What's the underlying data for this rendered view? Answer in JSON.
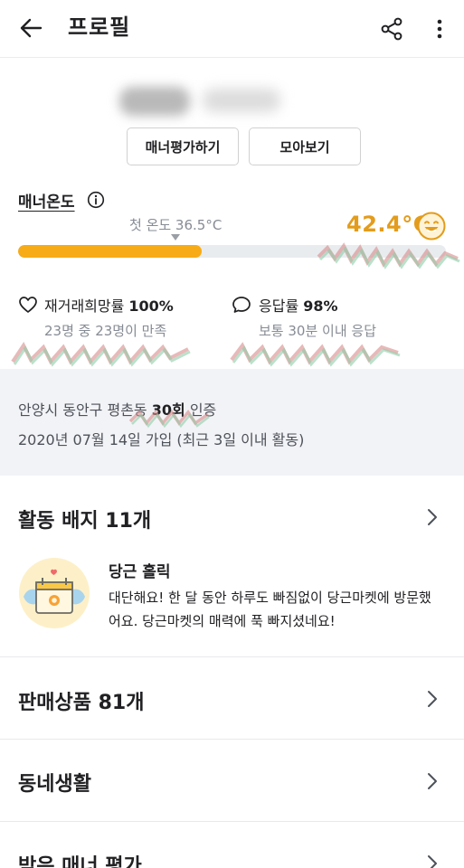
{
  "header": {
    "title": "프로필",
    "back_icon": "arrow-left-icon",
    "share_icon": "share-icon",
    "more_icon": "more-vertical-icon"
  },
  "profile": {
    "manner_eval_button": "매너평가하기",
    "collection_button": "모아보기"
  },
  "manner": {
    "title": "매너온도",
    "first_temp_label": "첫 온도 36.5°C",
    "temperature": "42.4°C",
    "temperature_fraction": 0.43,
    "accent_color": "#f7ab16",
    "temp_text_color": "#e39c1b"
  },
  "stats": {
    "rehire": {
      "label": "재거래희망률 ",
      "value": "100%",
      "sub": "23명 중 23명이 만족"
    },
    "response": {
      "label": "응답률 ",
      "value": "98%",
      "sub": "보통 30분 이내 응답"
    }
  },
  "location": {
    "prefix": "안양시 동안구 평촌동 ",
    "count": "30회",
    "suffix": " 인증",
    "joined": "2020년 07월 14일 가입 (최근 3일 이내 활동)"
  },
  "sections": {
    "badges": {
      "title": "활동 배지 11개"
    },
    "badge": {
      "name": "당근 홀릭",
      "description": "대단해요! 한 달 동안 하루도 빠짐없이 당근마켓에 방문했어요. 당근마켓의 매력에 푹 빠지셨네요!"
    },
    "products": {
      "title": "판매상품 81개"
    },
    "community": {
      "title": "동네생활"
    },
    "reviews": {
      "title": "받은 매너 평가"
    }
  }
}
